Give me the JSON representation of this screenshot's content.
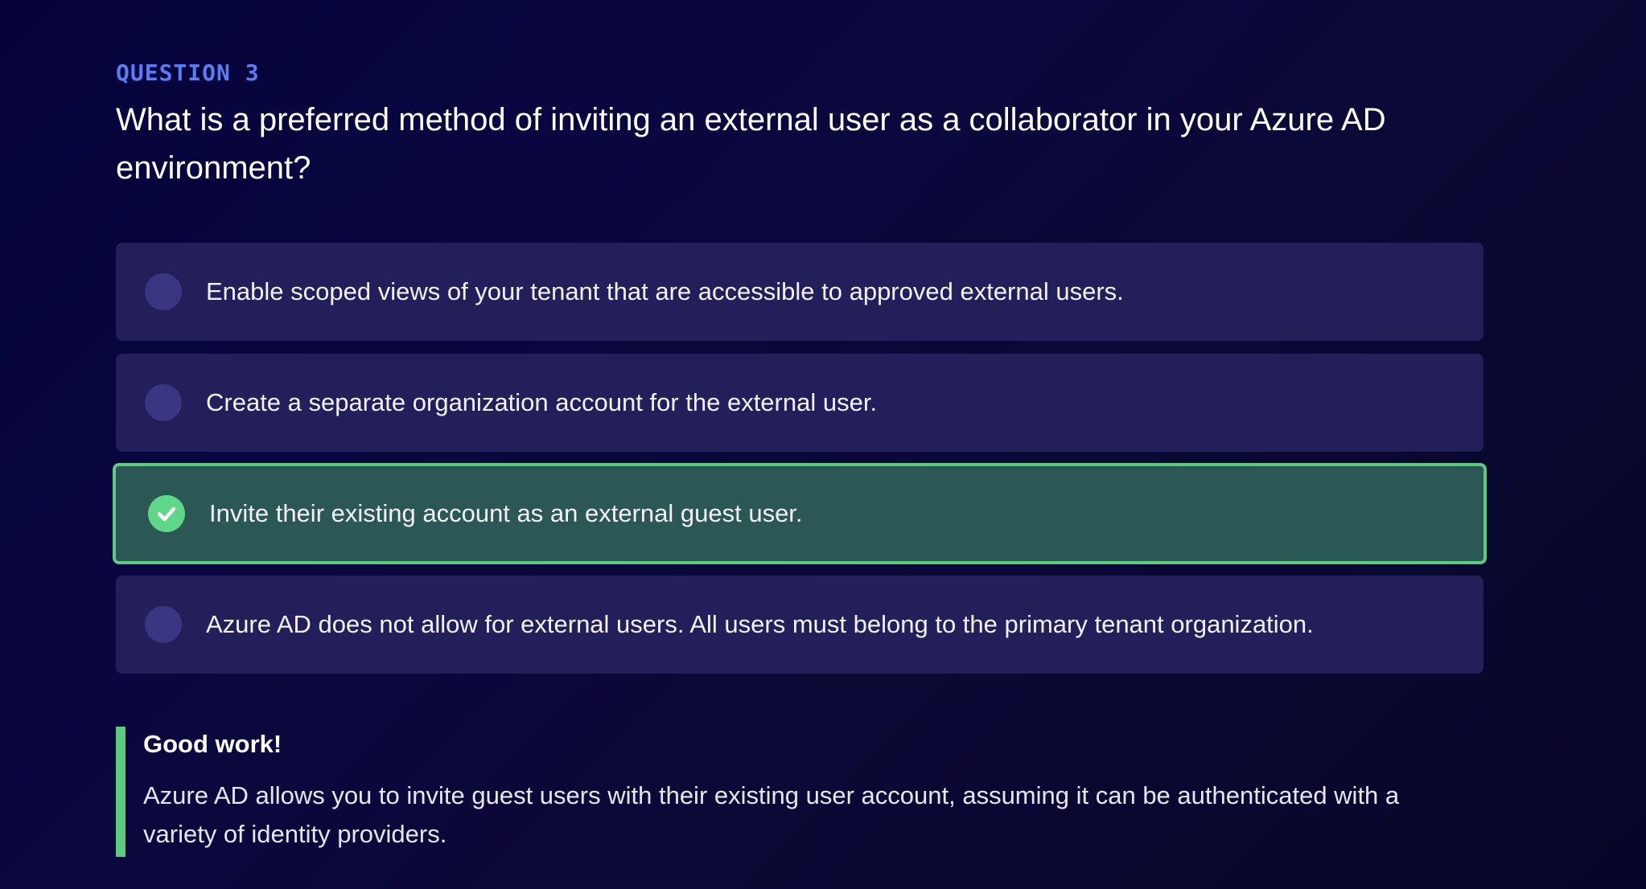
{
  "question": {
    "label": "QUESTION 3",
    "text": "What is a preferred method of inviting an external user as a collaborator in your Azure AD environment?"
  },
  "options": [
    {
      "text": "Enable scoped views of your tenant that are accessible to approved external users.",
      "state": "unselected"
    },
    {
      "text": "Create a separate organization account for the external user.",
      "state": "unselected"
    },
    {
      "text": "Invite their existing account as an external guest user.",
      "state": "correct"
    },
    {
      "text": "Azure AD does not allow for external users. All users must belong to the primary tenant organization.",
      "state": "unselected"
    }
  ],
  "feedback": {
    "title": "Good work!",
    "body": "Azure AD allows you to invite guest users with their existing user account, assuming it can be authenticated with a variety of identity providers."
  },
  "icons": {
    "unselected": "radio-empty-icon",
    "correct": "check-circle-icon"
  },
  "colors": {
    "accent_label": "#5b7cf5",
    "option_bg": "#221f5a",
    "correct_bg": "#2b5755",
    "correct_border": "#5ccb7d",
    "radio_empty": "#3a3682",
    "check_fill": "#5ed888"
  }
}
